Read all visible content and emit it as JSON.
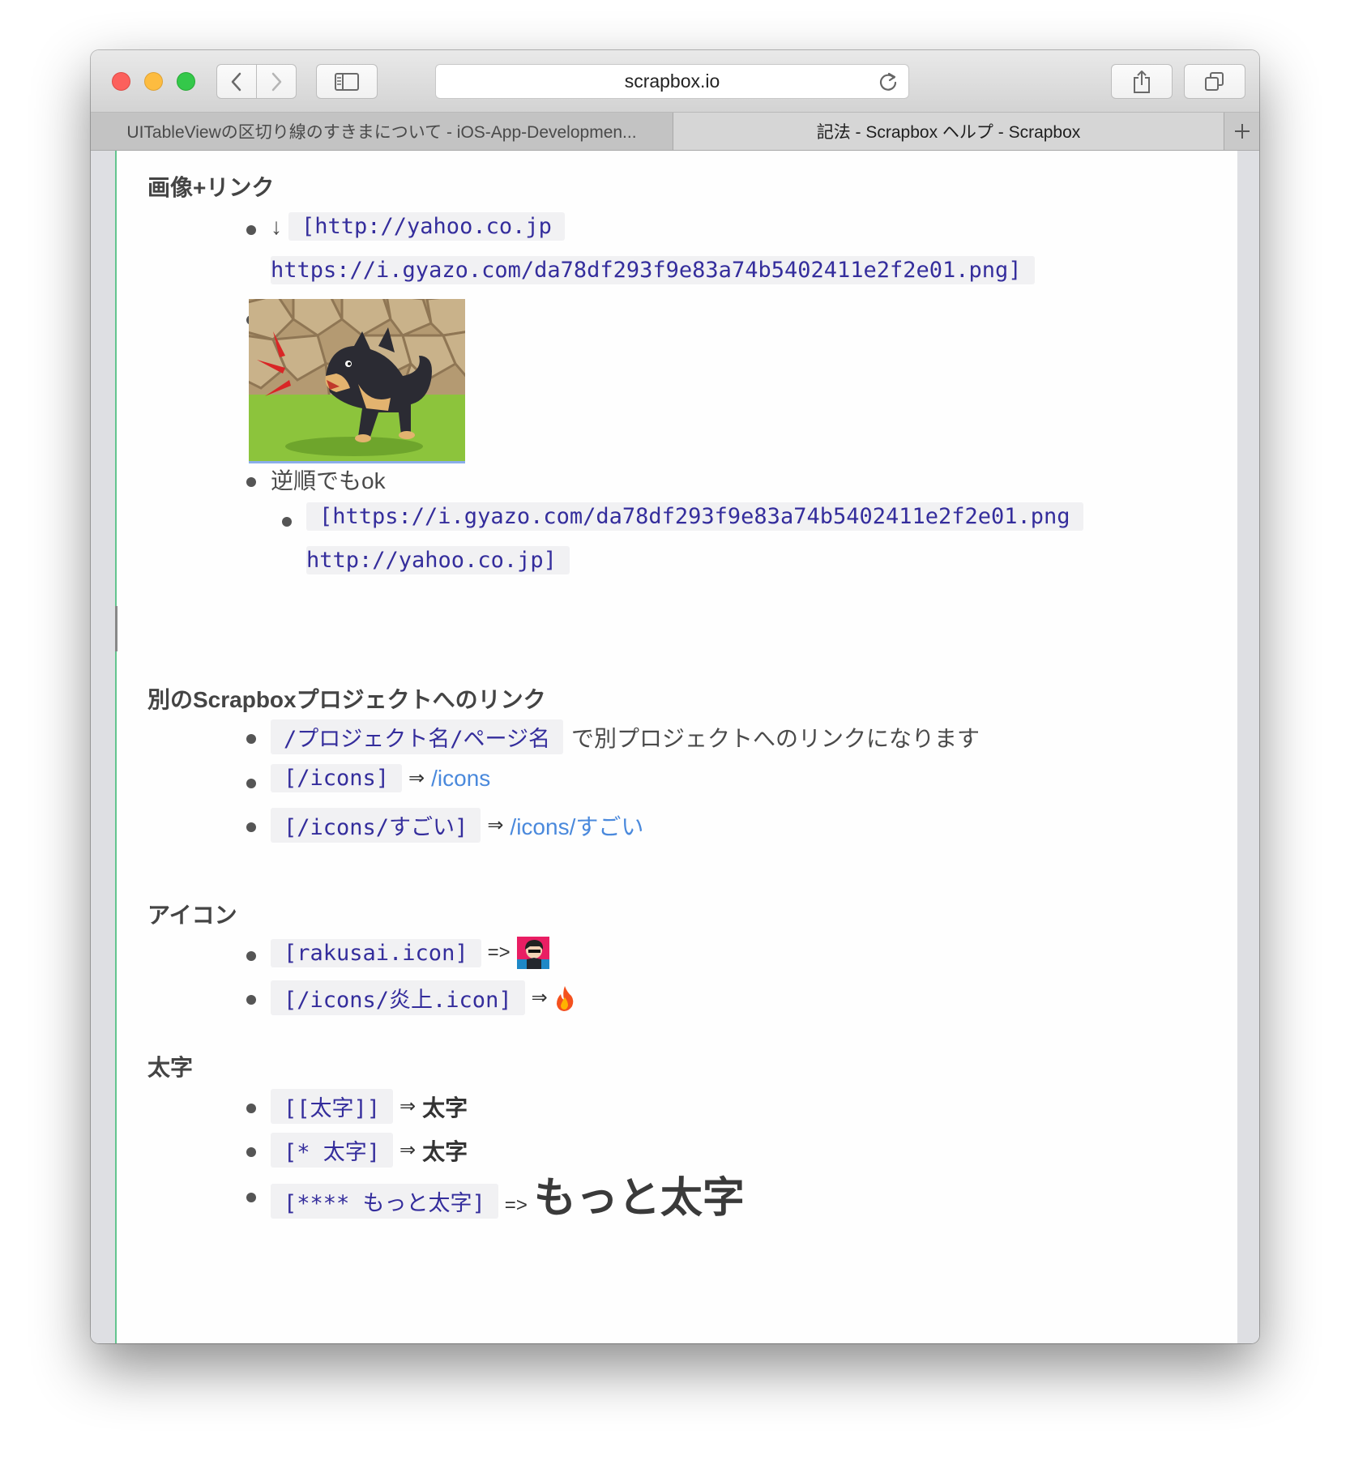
{
  "browser": {
    "address": "scrapbox.io",
    "tabs": [
      {
        "label": "UITableViewの区切り線のすきまについて - iOS-App-Developmen..."
      },
      {
        "label": "記法 - Scrapbox ヘルプ - Scrapbox"
      }
    ],
    "new_tab_label": "+"
  },
  "content": {
    "image_link": {
      "heading": "画像+リンク",
      "item1_arrow": "↓",
      "item1_code_line1": "[http://yahoo.co.jp",
      "item1_code_line2": "https://i.gyazo.com/da78df293f9e83a74b5402411e2f2e01.png]",
      "reverse_text": "逆順でもok",
      "reverse_code_line1": "[https://i.gyazo.com/da78df293f9e83a74b5402411e2f2e01.png",
      "reverse_code_line2": "http://yahoo.co.jp]"
    },
    "project_link": {
      "heading": "別のScrapboxプロジェクトへのリンク",
      "item1_code": "/プロジェクト名/ページ名",
      "item1_text": "で別プロジェクトへのリンクになります",
      "item2_code": "[/icons]",
      "item2_arrow": "⇒",
      "item2_link": "/icons",
      "item3_code": "[/icons/すごい]",
      "item3_arrow": "⇒",
      "item3_link": "/icons/すごい"
    },
    "icon_section": {
      "heading": "アイコン",
      "item1_code": "[rakusai.icon]",
      "item1_arrow": "=>",
      "item2_code": "[/icons/炎上.icon]",
      "item2_arrow": "⇒"
    },
    "bold_section": {
      "heading": "太字",
      "item1_code": "[[太字]]",
      "item1_arrow": "⇒",
      "item1_result": "太字",
      "item2_code": "[* 太字]",
      "item2_arrow": "⇒",
      "item2_result": "太字",
      "item3_code": "[**** もっと太字]",
      "item3_arrow": "=>",
      "item3_result": "もっと太字"
    }
  },
  "colors": {
    "link": "#4a89dc",
    "code_text": "#342d9c",
    "code_bg": "#f1f1f3",
    "page_accent": "#63c48f"
  }
}
